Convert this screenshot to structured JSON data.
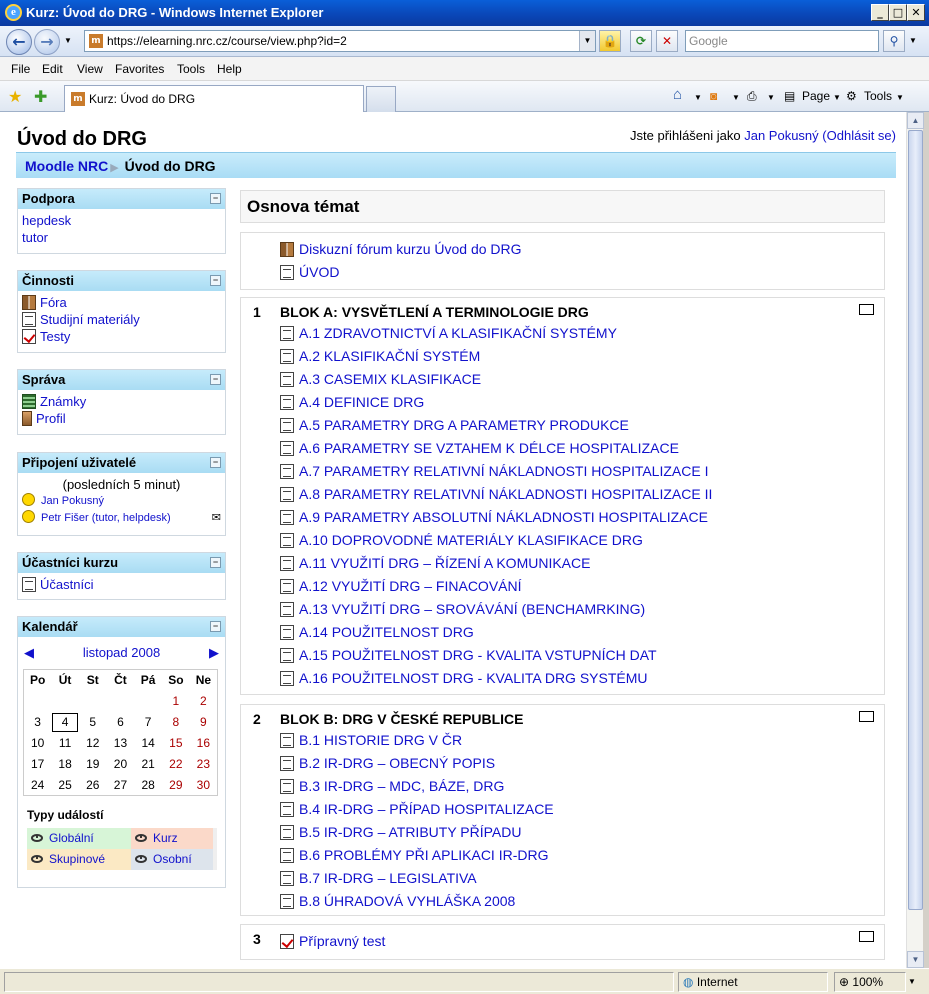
{
  "window": {
    "title": "Kurz: Úvod do DRG - Windows Internet Explorer",
    "url": "https://elearning.nrc.cz/course/view.php?id=2",
    "search_placeholder": "Google",
    "tab_label": "Kurz: Úvod do DRG",
    "menu": [
      "File",
      "Edit",
      "View",
      "Favorites",
      "Tools",
      "Help"
    ],
    "commands": {
      "page": "Page",
      "tools": "Tools"
    },
    "status_zone": "Internet",
    "zoom": "100%"
  },
  "header": {
    "course_title": "Úvod do DRG",
    "login_prefix": "Jste přihlášeni jako",
    "user_name": "Jan Pokusný",
    "logout": "(Odhlásit se)",
    "breadcrumb": {
      "home": "Moodle NRC",
      "current": "Úvod do DRG"
    }
  },
  "sidebar": {
    "podpora": {
      "title": "Podpora",
      "links": [
        "hepdesk",
        "tutor"
      ]
    },
    "cinnosti": {
      "title": "Činnosti",
      "items": [
        "Fóra",
        "Studijní materiály",
        "Testy"
      ]
    },
    "sprava": {
      "title": "Správa",
      "items": [
        "Známky",
        "Profil"
      ]
    },
    "pripojeni": {
      "title": "Připojení uživatelé",
      "period": "(posledních 5 minut)",
      "users": [
        "Jan Pokusný",
        "Petr Fišer (tutor, helpdesk)"
      ]
    },
    "ucastnici": {
      "title": "Účastníci kurzu",
      "link": "Účastníci"
    },
    "kalendar": {
      "title": "Kalendář",
      "month": "listopad 2008",
      "days": [
        "Po",
        "Út",
        "St",
        "Čt",
        "Pá",
        "So",
        "Ne"
      ],
      "weeks": [
        [
          "",
          "",
          "",
          "",
          "",
          "1",
          "2"
        ],
        [
          "3",
          "4",
          "5",
          "6",
          "7",
          "8",
          "9"
        ],
        [
          "10",
          "11",
          "12",
          "13",
          "14",
          "15",
          "16"
        ],
        [
          "17",
          "18",
          "19",
          "20",
          "21",
          "22",
          "23"
        ],
        [
          "24",
          "25",
          "26",
          "27",
          "28",
          "29",
          "30"
        ]
      ],
      "today": "4",
      "event_types_title": "Typy událostí",
      "event_types": [
        "Globální",
        "Kurz",
        "Skupinové",
        "Osobní"
      ]
    }
  },
  "main": {
    "heading": "Osnova témat",
    "section0": [
      "Diskuzní fórum kurzu Úvod do DRG",
      "ÚVOD"
    ],
    "section1": {
      "num": "1",
      "title": "BLOK A: VYSVĚTLENÍ A TERMINOLOGIE DRG",
      "items": [
        "A.1 ZDRAVOTNICTVÍ A KLASIFIKAČNÍ SYSTÉMY",
        "A.2 KLASIFIKAČNÍ SYSTÉM",
        "A.3 CASEMIX KLASIFIKACE",
        "A.4 DEFINICE DRG",
        "A.5 PARAMETRY DRG A PARAMETRY PRODUKCE",
        "A.6 PARAMETRY SE VZTAHEM K DÉLCE HOSPITALIZACE",
        "A.7 PARAMETRY RELATIVNÍ NÁKLADNOSTI HOSPITALIZACE I",
        "A.8 PARAMETRY RELATIVNÍ NÁKLADNOSTI HOSPITALIZACE II",
        "A.9 PARAMETRY ABSOLUTNÍ NÁKLADNOSTI HOSPITALIZACE",
        "A.10 DOPROVODNÉ MATERIÁLY KLASIFIKACE DRG",
        "A.11 VYUŽITÍ DRG – ŘÍZENÍ A KOMUNIKACE",
        "A.12 VYUŽITÍ DRG – FINACOVÁNÍ",
        "A.13 VYUŽITÍ DRG – SROVÁVÁNÍ (BENCHAMRKING)",
        "A.14 POUŽITELNOST DRG",
        "A.15 POUŽITELNOST DRG - KVALITA VSTUPNÍCH DAT",
        "A.16 POUŽITELNOST DRG - KVALITA DRG SYSTÉMU"
      ]
    },
    "section2": {
      "num": "2",
      "title": "BLOK B: DRG V ČESKÉ REPUBLICE",
      "items": [
        "B.1 HISTORIE DRG V ČR",
        "B.2 IR-DRG – OBECNÝ POPIS",
        "B.3 IR-DRG – MDC, BÁZE, DRG",
        "B.4 IR-DRG – PŘÍPAD HOSPITALIZACE",
        "B.5 IR-DRG – ATRIBUTY PŘÍPADU",
        "B.6 PROBLÉMY PŘI APLIKACI IR-DRG",
        "B.7 IR-DRG – LEGISLATIVA",
        "B.8 ÚHRADOVÁ VYHLÁŠKA 2008"
      ]
    },
    "section3": {
      "num": "3",
      "items": [
        "Přípravný test"
      ]
    }
  }
}
